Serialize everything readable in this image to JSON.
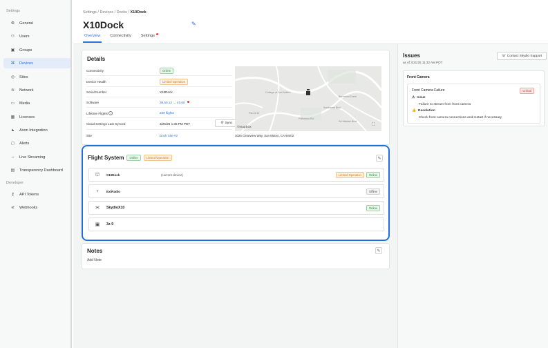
{
  "sidebar": {
    "section_settings": "Settings",
    "section_developer": "Developer",
    "items": [
      {
        "label": "General",
        "icon": "gear-icon"
      },
      {
        "label": "Users",
        "icon": "users-icon"
      },
      {
        "label": "Groups",
        "icon": "groups-icon"
      },
      {
        "label": "Devices",
        "icon": "devices-icon",
        "active": true
      },
      {
        "label": "Sites",
        "icon": "location-pin-icon"
      },
      {
        "label": "Network",
        "icon": "wifi-icon"
      },
      {
        "label": "Media",
        "icon": "media-icon"
      },
      {
        "label": "Licenses",
        "icon": "licenses-icon"
      },
      {
        "label": "Axon Integration",
        "icon": "triangle-icon"
      },
      {
        "label": "Alerts",
        "icon": "alert-icon"
      },
      {
        "label": "Live Streaming",
        "icon": "live-stream-icon"
      },
      {
        "label": "Transparency Dashboard",
        "icon": "dashboard-icon"
      }
    ],
    "dev_items": [
      {
        "label": "API Tokens",
        "icon": "key-icon"
      },
      {
        "label": "Webhooks",
        "icon": "webhook-icon"
      }
    ]
  },
  "breadcrumb": {
    "parts": [
      "Settings",
      "Devices",
      "Docks"
    ],
    "separator": "/",
    "current": "X10Dock"
  },
  "page": {
    "title": "X10Dock",
    "tabs": [
      {
        "label": "Overview",
        "active": true
      },
      {
        "label": "Connectivity",
        "active": false
      },
      {
        "label": "Settings",
        "active": false,
        "dot": true
      }
    ]
  },
  "details": {
    "title": "Details",
    "rows": [
      {
        "label": "Connectivity",
        "value": "Online",
        "kind": "badge-green"
      },
      {
        "label": "Device Health",
        "value": "Limited Operation",
        "kind": "badge-orange"
      },
      {
        "label": "Serial Number",
        "value": "X10Dock",
        "kind": "text"
      },
      {
        "label": "Software",
        "value": "39.50.12 → 40.60",
        "kind": "link-dot"
      },
      {
        "label": "Lifetime Flights",
        "value": "339 flights",
        "kind": "link",
        "info": true
      },
      {
        "label": "Cloud Settings Last Synced",
        "value": "3/25/25 1:35 PM PDT",
        "kind": "text"
      },
      {
        "label": "Site",
        "value": "Dock Site #2",
        "kind": "link"
      }
    ],
    "sync_label": "Sync",
    "map": {
      "labels": [
        "College of San Mateo",
        "Beresford Creek",
        "Southwest Blvd",
        "Parrott Dr",
        "Polhemus Rd",
        "W Hillsdale Blvd"
      ],
      "logo": "©mapbox",
      "address": "3025 Clearview Way, San Mateo, CA 94402"
    }
  },
  "flight_system": {
    "title": "Flight System",
    "badges": [
      "Online",
      "Limited Operation"
    ],
    "rows": [
      {
        "name": "X10Dock",
        "note": "(current device)",
        "icon": "dock-icon",
        "badges": [
          {
            "text": "Limited Operation",
            "kind": "orange"
          },
          {
            "text": "Online",
            "kind": "gray-green"
          }
        ]
      },
      {
        "name": "ExtRadio",
        "note": "",
        "icon": "radio-icon",
        "badges": [
          {
            "text": "Offline",
            "kind": "gray"
          }
        ]
      },
      {
        "name": "SkydioX10",
        "note": "",
        "icon": "drone-icon",
        "badges": [
          {
            "text": "Online",
            "kind": "green"
          }
        ]
      },
      {
        "name": "3z-9",
        "note": "",
        "icon": "controller-icon",
        "badges": []
      }
    ]
  },
  "notes": {
    "title": "Notes",
    "add_label": "Add Note"
  },
  "issues": {
    "title": "Issues",
    "as_of": "as of 3/31/25 11:32 AM PDT",
    "contact_label": "Contact Skydio Support",
    "section": "Front Camera",
    "failure_title": "Front Camera Failure",
    "severity": "Critical",
    "issue_heading": "Issue",
    "issue_text": "Failure to stream from front camera",
    "resolution_heading": "Resolution",
    "resolution_text": "Check front camera connections and restart if necessary"
  },
  "colors": {
    "accent": "#2f6fd6",
    "highlight_border": "#1d6fe0",
    "online": "#2c8b3c",
    "limited": "#c77b12",
    "critical": "#c0392b"
  }
}
